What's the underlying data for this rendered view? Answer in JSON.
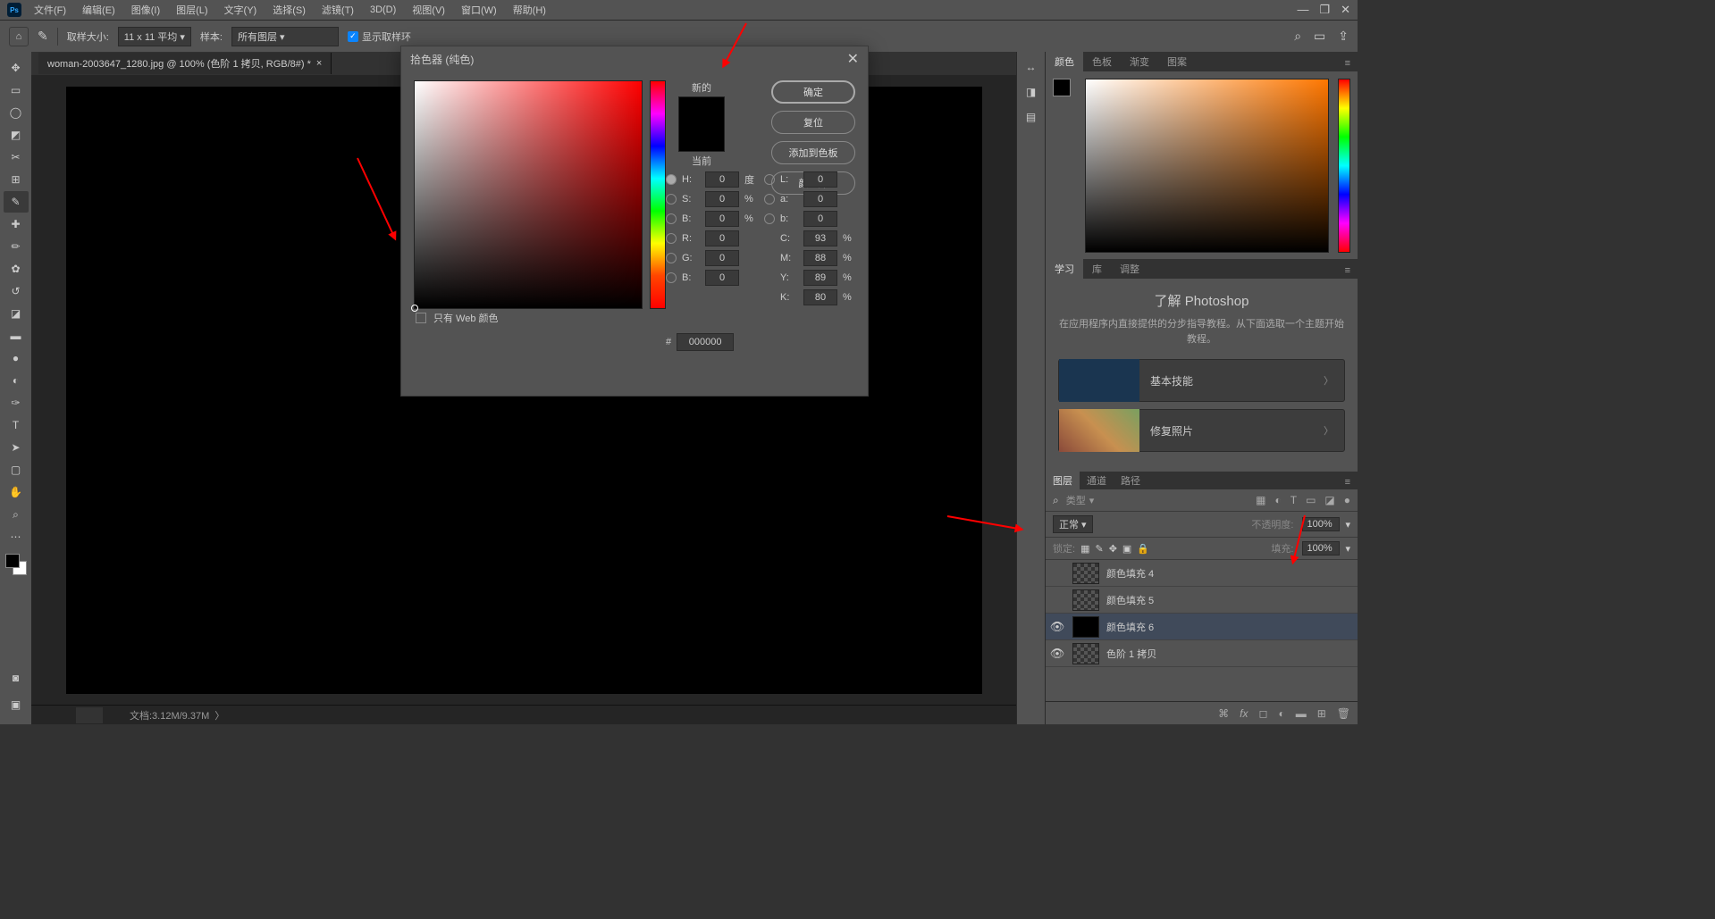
{
  "menu": {
    "file": "文件(F)",
    "edit": "编辑(E)",
    "image": "图像(I)",
    "layer": "图层(L)",
    "type": "文字(Y)",
    "select": "选择(S)",
    "filter": "滤镜(T)",
    "td": "3D(D)",
    "view": "视图(V)",
    "window": "窗口(W)",
    "help": "帮助(H)"
  },
  "optbar": {
    "sample_size_label": "取样大小:",
    "sample_size": "11 x 11 平均",
    "sample_label": "样本:",
    "sample": "所有图层",
    "ring": "显示取样环"
  },
  "tab": {
    "name": "woman-2003647_1280.jpg @ 100% (色阶 1 拷贝, RGB/8#) *"
  },
  "status": {
    "doc": "文档:3.12M/9.37M"
  },
  "panels": {
    "color_tabs": {
      "color": "颜色",
      "swatch": "色板",
      "grad": "渐变",
      "pattern": "图案"
    },
    "learn_tabs": {
      "learn": "学习",
      "lib": "库",
      "adjust": "调整"
    },
    "layer_tabs": {
      "layers": "图层",
      "channels": "通道",
      "paths": "路径"
    }
  },
  "learn": {
    "title": "了解 Photoshop",
    "desc": "在应用程序内直接提供的分步指导教程。从下面选取一个主题开始教程。",
    "card1": "基本技能",
    "card2": "修复照片"
  },
  "layers": {
    "search": "类型",
    "blend": "正常",
    "opacity_label": "不透明度:",
    "opacity": "100%",
    "lock_label": "锁定:",
    "fill_label": "填充:",
    "fill": "100%",
    "items": [
      {
        "visible": false,
        "name": "颜色填充 4"
      },
      {
        "visible": false,
        "name": "颜色填充 5"
      },
      {
        "visible": true,
        "name": "颜色填充 6",
        "selected": true
      },
      {
        "visible": true,
        "name": "色阶 1 拷贝"
      }
    ]
  },
  "dialog": {
    "title": "拾色器 (纯色)",
    "new": "新的",
    "current": "当前",
    "ok": "确定",
    "reset": "复位",
    "addswatch": "添加到色板",
    "libs": "颜色库",
    "webonly": "只有 Web 颜色",
    "hex": "000000",
    "fields": {
      "H": "0",
      "S": "0",
      "B": "0",
      "R": "0",
      "G": "0",
      "B2": "0",
      "L": "0",
      "a": "0",
      "b": "0",
      "C": "93",
      "M": "88",
      "Y": "89",
      "K": "80"
    },
    "units": {
      "deg": "度",
      "pct": "%"
    }
  }
}
